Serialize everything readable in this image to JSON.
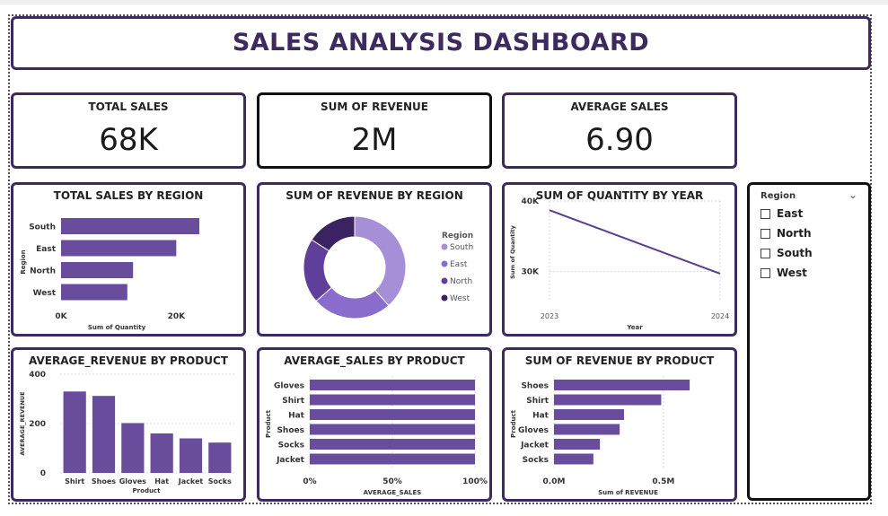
{
  "dashboard": {
    "title": "SALES ANALYSIS DASHBOARD"
  },
  "kpis": [
    {
      "label": "TOTAL SALES",
      "value": "68K"
    },
    {
      "label": "SUM OF REVENUE",
      "value": "2M"
    },
    {
      "label": "AVERAGE SALES",
      "value": "6.90"
    }
  ],
  "slicer": {
    "title": "Region",
    "options": [
      "East",
      "North",
      "South",
      "West"
    ],
    "colors": {
      "border": "#111111",
      "checkbox": "#444444"
    }
  },
  "colors": {
    "bar": "#6a4c9c",
    "line": "#5a3e8c",
    "border": "#3d2a5e",
    "grid": "#d8d8d8"
  },
  "chart_data": [
    {
      "type": "bar",
      "orientation": "horizontal",
      "title": "TOTAL SALES BY REGION",
      "ylabel": "Region",
      "xlabel": "Sum of Quantity",
      "categories": [
        "South",
        "East",
        "North",
        "West"
      ],
      "values": [
        24000,
        20000,
        12500,
        11500
      ],
      "xlim": [
        0,
        24000
      ],
      "xticks": [
        "0K",
        "20K"
      ],
      "xtick_values": [
        0,
        20000
      ]
    },
    {
      "type": "pie",
      "variant": "donut",
      "title": "SUM OF REVENUE BY REGION",
      "legend_title": "Region",
      "legend_placement": "right",
      "labels": [
        "South",
        "East",
        "North",
        "West"
      ],
      "values": [
        580000,
        380000,
        310000,
        240000
      ],
      "colors": [
        "#a78fd8",
        "#8a6ccd",
        "#5f3f9a",
        "#3a2360"
      ]
    },
    {
      "type": "line",
      "title": "SUM OF QUANTITY BY YEAR",
      "xlabel": "Year",
      "ylabel": "Sum of Quantity",
      "x": [
        "2023",
        "2024"
      ],
      "values": [
        38700,
        29700
      ],
      "ylim": [
        26000,
        40000
      ],
      "yticks": [
        "40K",
        "30K"
      ],
      "ytick_values": [
        40000,
        30000
      ],
      "grid": true
    },
    {
      "type": "bar",
      "orientation": "vertical",
      "title": "AVERAGE_REVENUE BY PRODUCT",
      "xlabel": "Product",
      "ylabel": "AVERAGE_REVENUE",
      "categories": [
        "Shirt",
        "Shoes",
        "Gloves",
        "Hat",
        "Jacket",
        "Socks"
      ],
      "values": [
        330,
        312,
        202,
        160,
        140,
        123
      ],
      "ylim": [
        0,
        400
      ],
      "yticks": [
        "400",
        "200",
        "0"
      ],
      "ytick_values": [
        400,
        200,
        0
      ],
      "grid": true
    },
    {
      "type": "bar",
      "orientation": "horizontal",
      "stacked": "100%",
      "title": "AVERAGE_SALES BY PRODUCT",
      "xlabel": "AVERAGE_SALES",
      "ylabel": "Product",
      "categories": [
        "Gloves",
        "Shirt",
        "Hat",
        "Shoes",
        "Socks",
        "Jacket"
      ],
      "values": [
        100,
        100,
        100,
        100,
        100,
        100
      ],
      "xlim": [
        0,
        100
      ],
      "xticks": [
        "0%",
        "50%",
        "100%"
      ],
      "xtick_values": [
        0,
        50,
        100
      ],
      "grid": true
    },
    {
      "type": "bar",
      "orientation": "horizontal",
      "title": "SUM OF REVENUE BY PRODUCT",
      "xlabel": "Sum of REVENUE",
      "ylabel": "Product",
      "categories": [
        "Shoes",
        "Shirt",
        "Hat",
        "Gloves",
        "Jacket",
        "Socks"
      ],
      "values": [
        0.62,
        0.49,
        0.32,
        0.3,
        0.21,
        0.18
      ],
      "xlim": [
        0,
        0.8
      ],
      "xticks": [
        "0.0M",
        "0.5M"
      ],
      "xtick_values": [
        0,
        0.5
      ],
      "grid": true
    }
  ]
}
